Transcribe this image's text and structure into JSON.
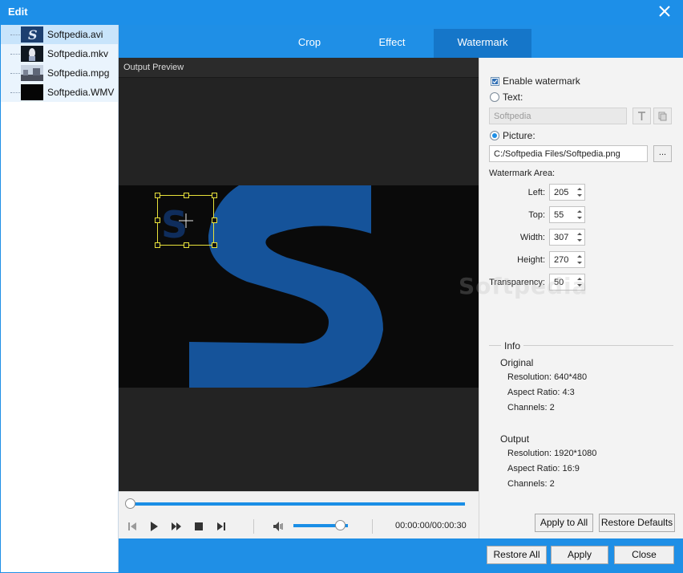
{
  "window": {
    "title": "Edit"
  },
  "files": [
    {
      "name": "Softpedia.avi",
      "selected": true
    },
    {
      "name": "Softpedia.mkv",
      "selected": false
    },
    {
      "name": "Softpedia.mpg",
      "selected": false
    },
    {
      "name": "Softpedia.WMV",
      "selected": false
    }
  ],
  "tabs": [
    {
      "label": "Crop",
      "active": false
    },
    {
      "label": "Effect",
      "active": false
    },
    {
      "label": "Watermark",
      "active": true
    }
  ],
  "preview": {
    "header": "Output Preview",
    "time": "00:00:00/00:00:30",
    "seek_position": 0.0,
    "volume_level": 0.85
  },
  "watermark": {
    "enable_label": "Enable watermark",
    "enabled": true,
    "text_label": "Text:",
    "text_selected": false,
    "text_value": "Softpedia",
    "picture_label": "Picture:",
    "picture_selected": true,
    "picture_path": "C:/Softpedia Files/Softpedia.png",
    "browse_label": "...",
    "area_label": "Watermark Area:",
    "left_label": "Left:",
    "left_value": "205",
    "top_label": "Top:",
    "top_value": "55",
    "width_label": "Width:",
    "width_value": "307",
    "height_label": "Height:",
    "height_value": "270",
    "transparency_label": "Transparency:",
    "transparency_value": "50"
  },
  "info": {
    "title": "Info",
    "original_label": "Original",
    "original_resolution": "Resolution: 640*480",
    "original_aspect": "Aspect Ratio: 4:3",
    "original_channels": "Channels: 2",
    "output_label": "Output",
    "output_resolution": "Resolution: 1920*1080",
    "output_aspect": "Aspect Ratio: 16:9",
    "output_channels": "Channels: 2"
  },
  "buttons": {
    "apply_to_all": "Apply to All",
    "restore_defaults": "Restore Defaults",
    "restore_all": "Restore All",
    "apply": "Apply",
    "close": "Close"
  },
  "background_watermark": "Softpedia",
  "colors": {
    "accent": "#1f8fe6",
    "tab_active": "#1576c9",
    "logo_blue": "#15539a",
    "handle_yellow": "#e8e13a"
  }
}
